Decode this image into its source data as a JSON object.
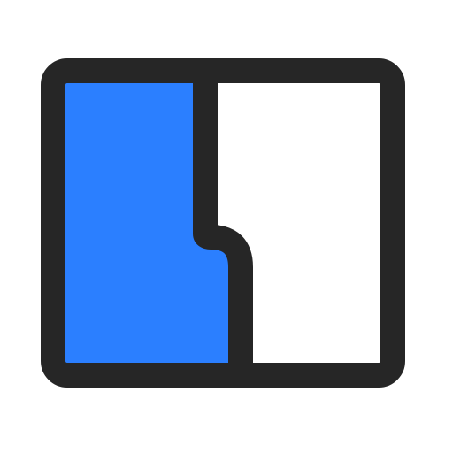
{
  "icon": {
    "name": "split-panel-layout-icon",
    "colors": {
      "outline": "#262626",
      "left_panel_fill": "#2B7FFF",
      "right_panel_fill": "#FFFFFF",
      "background": "#FFFFFF"
    }
  }
}
